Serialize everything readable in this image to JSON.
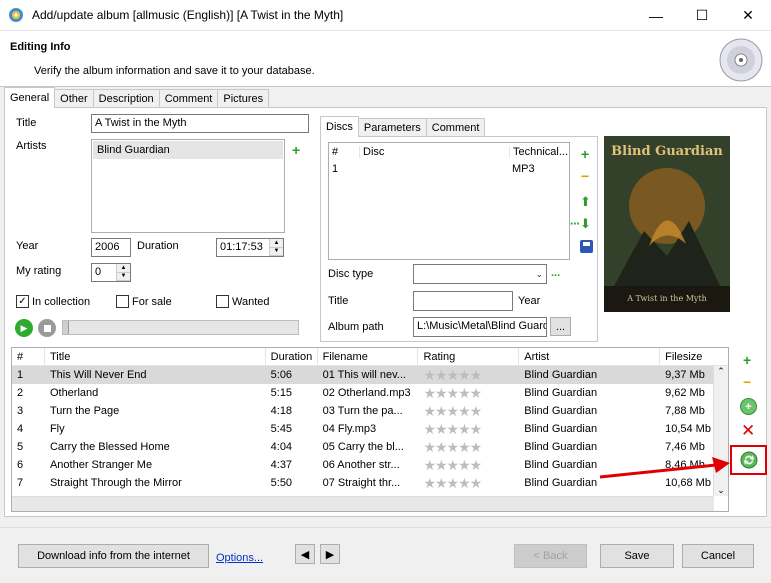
{
  "window": {
    "title": "Add/update album [allmusic (English)] [A Twist in the Myth]",
    "minimize": "—",
    "maximize": "☐",
    "close": "✕"
  },
  "header": {
    "title": "Editing Info",
    "subtitle": "Verify the album information and save it to your database."
  },
  "tabs": [
    "General",
    "Other",
    "Description",
    "Comment",
    "Pictures"
  ],
  "general": {
    "title_label": "Title",
    "title_value": "A Twist in the Myth",
    "artists_label": "Artists",
    "artists": [
      "Blind Guardian"
    ],
    "year_label": "Year",
    "year_value": "2006",
    "duration_label": "Duration",
    "duration_value": "01:17:53",
    "rating_label": "My rating",
    "rating_value": "0",
    "in_collection_label": "In collection",
    "for_sale_label": "For sale",
    "wanted_label": "Wanted",
    "in_collection_checked": "✓"
  },
  "subtabs": [
    "Discs",
    "Parameters",
    "Comment"
  ],
  "discs": {
    "headers": [
      "#",
      "Disc",
      "Technical..."
    ],
    "rows": [
      {
        "num": "1",
        "disc": "",
        "tech": "MP3"
      }
    ],
    "disc_type_label": "Disc type",
    "disc_type_value": "",
    "title_label": "Title",
    "title_value": "",
    "year_label": "Year",
    "path_label": "Album path",
    "path_value": "L:\\Music\\Metal\\Blind Guardi",
    "browse": "...",
    "more": "..."
  },
  "cover": {
    "band": "Blind Guardian",
    "album": "A Twist in the Myth"
  },
  "tracks": {
    "headers": [
      "#",
      "Title",
      "Duration",
      "Filename",
      "Rating",
      "Artist",
      "Filesize"
    ],
    "rows": [
      {
        "num": "1",
        "title": "This Will Never End",
        "duration": "5:06",
        "filename": "01 This will nev...",
        "artist": "Blind Guardian",
        "size": "9,37 Mb"
      },
      {
        "num": "2",
        "title": "Otherland",
        "duration": "5:15",
        "filename": "02 Otherland.mp3",
        "artist": "Blind Guardian",
        "size": "9,62 Mb"
      },
      {
        "num": "3",
        "title": "Turn the Page",
        "duration": "4:18",
        "filename": "03 Turn the pa...",
        "artist": "Blind Guardian",
        "size": "7,88 Mb"
      },
      {
        "num": "4",
        "title": "Fly",
        "duration": "5:45",
        "filename": "04 Fly.mp3",
        "artist": "Blind Guardian",
        "size": "10,54 Mb"
      },
      {
        "num": "5",
        "title": "Carry the Blessed Home",
        "duration": "4:04",
        "filename": "05 Carry the bl...",
        "artist": "Blind Guardian",
        "size": "7,46 Mb"
      },
      {
        "num": "6",
        "title": "Another Stranger Me",
        "duration": "4:37",
        "filename": "06 Another str...",
        "artist": "Blind Guardian",
        "size": "8,46 Mb"
      },
      {
        "num": "7",
        "title": "Straight Through the Mirror",
        "duration": "5:50",
        "filename": "07 Straight thr...",
        "artist": "Blind Guardian",
        "size": "10,68 Mb"
      }
    ],
    "stars": "★★★★★"
  },
  "footer": {
    "download": "Download info from the internet",
    "options": "Options...",
    "back": "< Back",
    "save": "Save",
    "cancel": "Cancel"
  },
  "colors": {
    "highlight_red": "#e00000",
    "link_blue": "#0033cc"
  }
}
